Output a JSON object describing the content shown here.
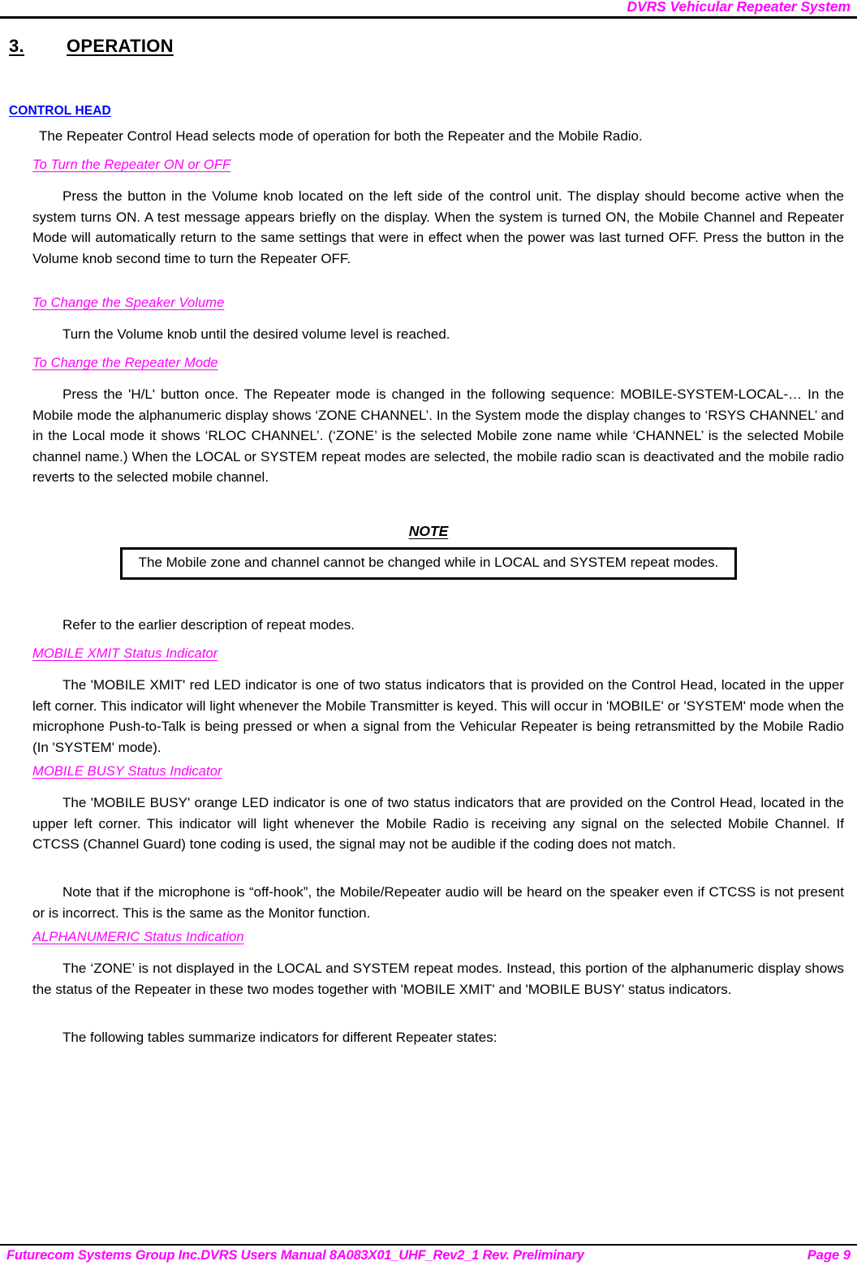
{
  "header": {
    "title": "DVRS Vehicular Repeater System"
  },
  "section": {
    "number": "3.",
    "title": "OPERATION",
    "subtitle": "CONTROL HEAD"
  },
  "body": {
    "intro": "The Repeater Control Head selects mode of operation for both the Repeater and the Mobile Radio.",
    "h3_power": "To Turn the Repeater ON or OFF",
    "p_power": "Press the button in the Volume knob located on the left side of the control unit. The display should become active when the system turns ON. A test message appears briefly on the display. When the system is turned ON, the Mobile Channel and Repeater Mode will automatically return to the same settings that were in effect when the power was last turned OFF. Press the button in the Volume knob second time to turn the Repeater OFF.",
    "h3_volume": "To Change the Speaker Volume",
    "p_volume": "Turn the Volume knob until the desired volume level is reached.",
    "h3_mode": "To Change the Repeater Mode",
    "p_mode": "Press the 'H/L' button once. The Repeater mode is changed in the following sequence: MOBILE-SYSTEM-LOCAL-… In the Mobile mode the alphanumeric display shows ‘ZONE CHANNEL’. In the System mode the display changes to ‘RSYS CHANNEL’ and in the Local mode it shows ‘RLOC CHANNEL’. (‘ZONE’ is the selected Mobile zone name while ‘CHANNEL’ is the selected Mobile channel name.) When the LOCAL or SYSTEM repeat modes are selected, the mobile radio scan is deactivated and the mobile radio reverts to the selected mobile channel.",
    "note_title": "NOTE",
    "note_text": "The Mobile zone and channel cannot be changed while in LOCAL and SYSTEM repeat modes.",
    "p_refer": "Refer to the earlier description of repeat modes.",
    "h3_xmit": "MOBILE XMIT Status Indicator",
    "p_xmit": "The 'MOBILE XMIT' red LED indicator is one of two status indicators that is provided on the Control Head, located in the upper left corner. This indicator will light whenever the Mobile Transmitter is keyed. This will occur in 'MOBILE' or 'SYSTEM' mode when the microphone Push-to-Talk is being pressed or when a signal from the Vehicular Repeater is being retransmitted by the Mobile Radio (In 'SYSTEM' mode).",
    "h3_busy": "MOBILE BUSY Status Indicator",
    "p_busy": "The 'MOBILE BUSY' orange LED indicator is one of two status indicators that are provided on the Control Head, located in the upper left corner. This indicator will light whenever the Mobile Radio is receiving any signal on the selected Mobile Channel. If CTCSS (Channel Guard) tone coding is used, the signal may not be audible if the coding does not match.",
    "p_offhook": "Note that if the microphone is “off-hook”, the Mobile/Repeater audio will be heard on the speaker even if CTCSS is not present or is incorrect. This is the same as the Monitor function.",
    "h3_alpha": "ALPHANUMERIC Status Indication",
    "p_alpha": "The ‘ZONE’ is not displayed in the LOCAL and SYSTEM repeat modes. Instead, this portion of the alphanumeric display shows the status of the Repeater in these two modes together with 'MOBILE XMIT' and 'MOBILE BUSY' status indicators.",
    "p_tables": "The following tables summarize indicators for different Repeater states:"
  },
  "footer": {
    "left": "Futurecom Systems Group Inc.DVRS Users Manual 8A083X01_UHF_Rev2_1 Rev. Preliminary",
    "page": "Page 9"
  }
}
